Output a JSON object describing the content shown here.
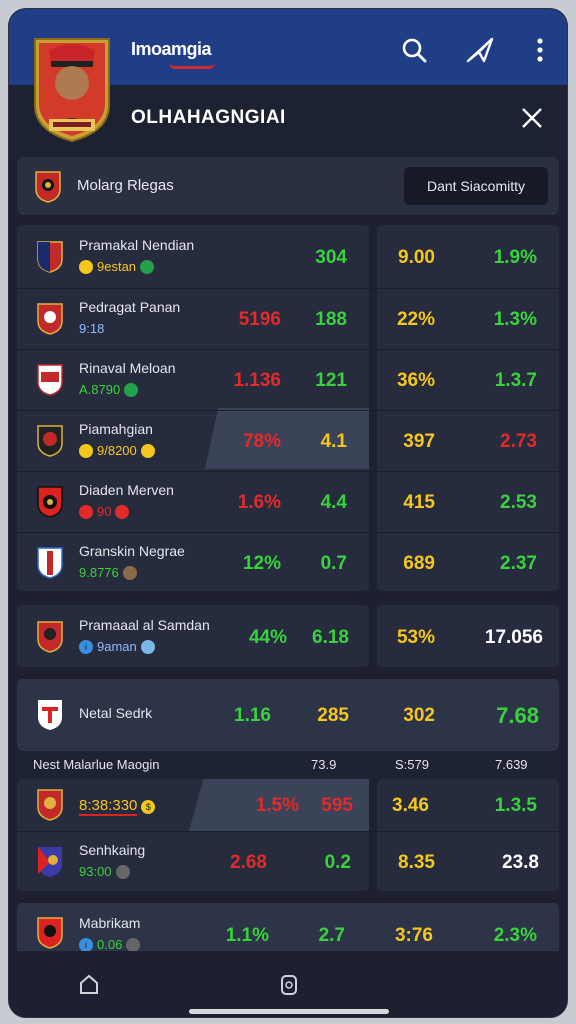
{
  "header": {
    "brand": "Imoamgia",
    "title": "OLHAHAGNGIAI",
    "icons": [
      "search-icon",
      "send-icon",
      "more-icon",
      "close-icon"
    ]
  },
  "filter": {
    "label": "Molarg Rlegas",
    "button": "Dant Siacomitty"
  },
  "rows": [
    {
      "name": "Pramakal Nendian",
      "sub": "9estan",
      "c1": "",
      "c2": "304",
      "c3": "9.00",
      "c4": "1.9%"
    },
    {
      "name": "Pedragat Panan",
      "sub": "9:18",
      "c1": "5196",
      "c2": "188",
      "c3": "22%",
      "c4": "1.3%"
    },
    {
      "name": "Rinaval Meloan",
      "sub": "A.8790",
      "c1": "1.136",
      "c2": "121",
      "c3": "36%",
      "c4": "1.3.7"
    },
    {
      "name": "Piamahgian",
      "sub": "9/8200",
      "c1": "78%",
      "c2": "4.1",
      "c3": "397",
      "c4": "2.73"
    },
    {
      "name": "Diaden Merven",
      "sub": "90",
      "c1": "1.6%",
      "c2": "4.4",
      "c3": "415",
      "c4": "2.53"
    },
    {
      "name": "Granskin Negrae",
      "sub": "9.8776",
      "c1": "12%",
      "c2": "0.7",
      "c3": "689",
      "c4": "2.37"
    }
  ],
  "summary": {
    "name": "Pramaaal al Samdan",
    "sub": "9aman",
    "c1": "44%",
    "c2": "6.18",
    "c3": "53%",
    "c4": "17.056"
  },
  "section": {
    "name": "Netal Sedrk",
    "c1": "1.16",
    "c2": "285",
    "c3": "302",
    "c4": "7.68"
  },
  "subhead": {
    "label": "Nest Malarlue Maogin",
    "h2": "73.9",
    "h3": "S:579",
    "h4": "7.639"
  },
  "lower_rows": [
    {
      "name": "",
      "sub": "8:38:330",
      "c1": "1.5%",
      "c2": "595",
      "c3": "3.46",
      "c4": "1.3.5"
    },
    {
      "name": "Senhkaing",
      "sub": "93:00",
      "c1": "2.68",
      "c2": "0.2",
      "c3": "8.35",
      "c4": "23.8"
    }
  ],
  "last_row": {
    "name": "Mabrikam",
    "sub": "0.06",
    "c1": "1.1%",
    "c2": "2.7",
    "c3": "3:76",
    "c4": "2.3%"
  },
  "colors": {
    "topbar": "#1f3e86",
    "green": "#39d23c",
    "red": "#e32a2a",
    "yellow": "#f5c61e",
    "panel": "#262c3d"
  }
}
